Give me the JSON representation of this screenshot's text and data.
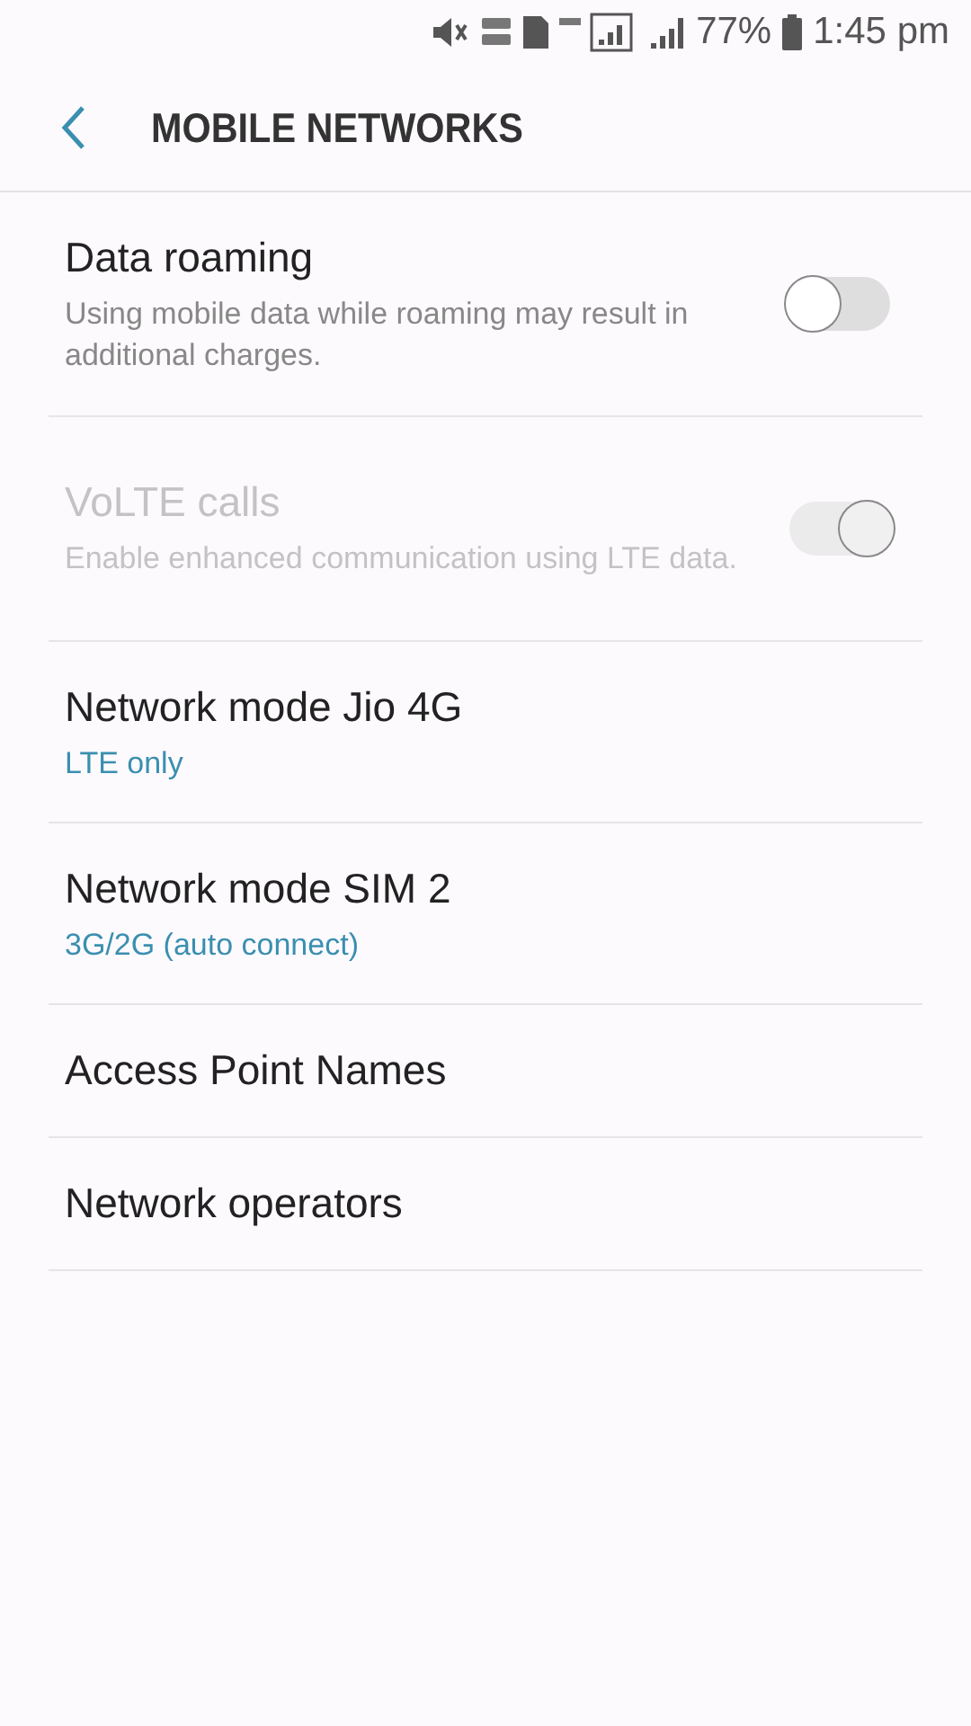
{
  "status_bar": {
    "battery": "77%",
    "time": "1:45 pm"
  },
  "header": {
    "title": "MOBILE NETWORKS"
  },
  "items": [
    {
      "kind": "toggle",
      "title": "Data roaming",
      "summary": "Using mobile data while roaming may result in additional charges.",
      "on": false,
      "disabled": false
    },
    {
      "kind": "toggle",
      "title": "VoLTE calls",
      "summary": "Enable enhanced communication using LTE data.",
      "on": true,
      "disabled": true
    },
    {
      "kind": "choice",
      "title": "Network mode Jio 4G",
      "value": "LTE only"
    },
    {
      "kind": "choice",
      "title": "Network mode SIM 2",
      "value": "3G/2G (auto connect)"
    },
    {
      "kind": "link",
      "title": "Access Point Names"
    },
    {
      "kind": "link",
      "title": "Network operators"
    }
  ]
}
